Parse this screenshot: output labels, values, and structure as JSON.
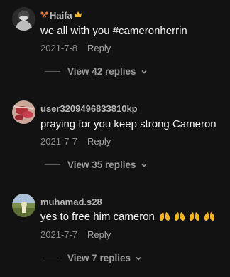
{
  "comments": [
    {
      "username": "Haifa",
      "prefix_icon": "butterfly-icon",
      "suffix_icon": "crown-icon",
      "text": "we all with you #cameronherrin",
      "date": "2021-7-8",
      "reply_label": "Reply",
      "view_replies": "View 42 replies"
    },
    {
      "username": "user3209496833810kp",
      "text": "praying for you keep strong Cameron",
      "date": "2021-7-7",
      "reply_label": "Reply",
      "view_replies": "View 35 replies"
    },
    {
      "username": "muhamad.s28",
      "text": "yes to free him cameron",
      "emoji_icon": "praying-hands-icon",
      "emoji_count": 4,
      "date": "2021-7-7",
      "reply_label": "Reply",
      "view_replies": "View 7 replies"
    }
  ],
  "colors": {
    "background": "#121212",
    "username": "#b4b4b4",
    "text": "#f2f2f2",
    "meta": "#8a8a8a",
    "emoji": "#f2b427"
  }
}
